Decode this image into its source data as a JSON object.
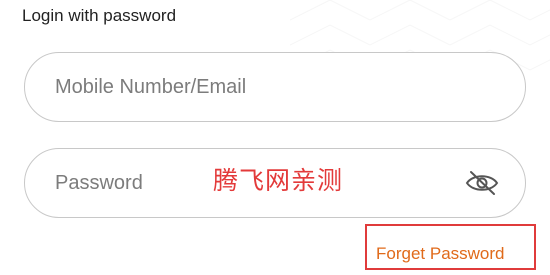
{
  "login": {
    "title": "Login with password",
    "mobile_placeholder": "Mobile Number/Email",
    "password_placeholder": "Password",
    "watermark": "腾飞网亲测",
    "forget_password": "Forget Password"
  },
  "icons": {
    "password_toggle": "eye-off-icon"
  },
  "colors": {
    "link": "#e06a1a",
    "highlight_box": "#e03b3b",
    "watermark": "#e33a3a",
    "border": "#c8c8c8"
  }
}
